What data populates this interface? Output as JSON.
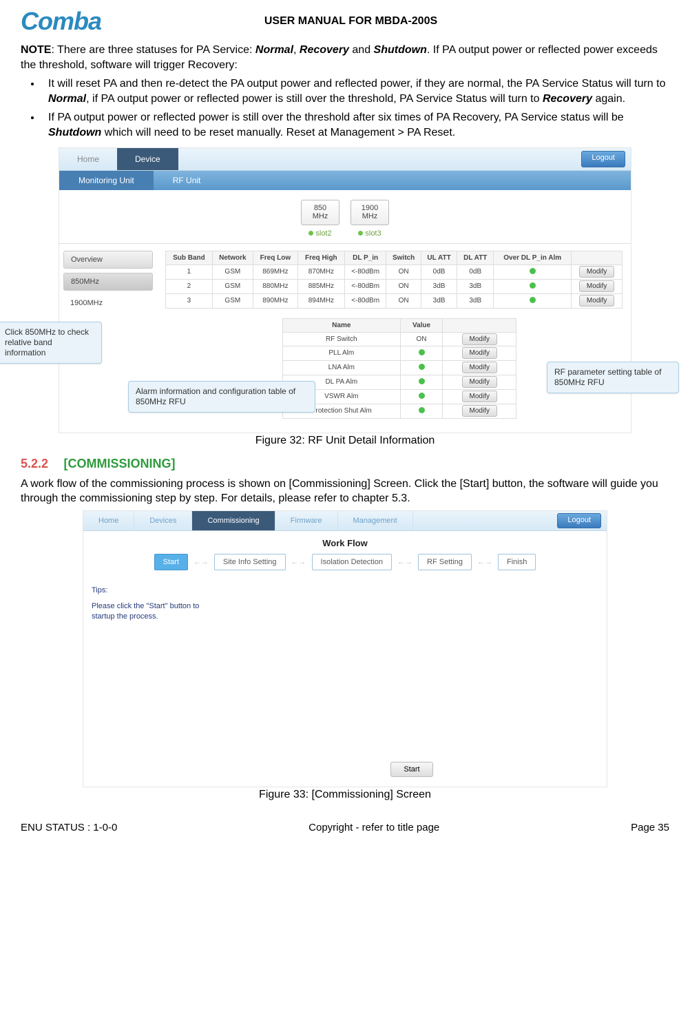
{
  "header": {
    "logo_text": "Comba",
    "title": "USER MANUAL FOR MBDA-200S"
  },
  "note": {
    "lead_bold": "NOTE",
    "lead_rest": ": There are three statuses for PA Service: ",
    "s1": "Normal",
    "s2": "Recovery",
    "s3": "Shutdown",
    "tail": ". If PA output power or reflected power exceeds the threshold, software will trigger Recovery:"
  },
  "bullets": {
    "b1a": "It will reset PA and then re-detect the PA output power and reflected power, if they are normal, the PA Service Status will turn to ",
    "b1_normal": "Normal",
    "b1b": ", if PA output power or reflected power is still over the threshold, PA Service Status will turn to ",
    "b1_recovery": "Recovery",
    "b1c": " again.",
    "b2a": "If PA output power or reflected power is still over the threshold after six times of PA Recovery, PA Service status will be ",
    "b2_shutdown": "Shutdown",
    "b2b": " which will need to be reset manually. Reset at Management > PA Reset."
  },
  "fig32": {
    "nav": {
      "home": "Home",
      "device": "Device",
      "logout": "Logout"
    },
    "subnav": {
      "mu": "Monitoring Unit",
      "rf": "RF Unit"
    },
    "slots": [
      {
        "line1": "850",
        "line2": "MHz",
        "label": "slot2"
      },
      {
        "line1": "1900",
        "line2": "MHz",
        "label": "slot3"
      }
    ],
    "sidebar": {
      "overview": "Overview",
      "b850": "850MHz",
      "b1900": "1900MHz"
    },
    "cols": [
      "Sub Band",
      "Network",
      "Freq Low",
      "Freq High",
      "DL P_in",
      "Switch",
      "UL ATT",
      "DL ATT",
      "Over DL P_in Alm",
      ""
    ],
    "rows": [
      [
        "1",
        "GSM",
        "869MHz",
        "870MHz",
        "<-80dBm",
        "ON",
        "0dB",
        "0dB"
      ],
      [
        "2",
        "GSM",
        "880MHz",
        "885MHz",
        "<-80dBm",
        "ON",
        "3dB",
        "3dB"
      ],
      [
        "3",
        "GSM",
        "890MHz",
        "894MHz",
        "<-80dBm",
        "ON",
        "3dB",
        "3dB"
      ]
    ],
    "modify": "Modify",
    "nv_cols": [
      "Name",
      "Value",
      ""
    ],
    "nv_rows": [
      [
        "RF Switch",
        "ON"
      ],
      [
        "PLL Alm",
        "led"
      ],
      [
        "LNA Alm",
        "led"
      ],
      [
        "DL PA Alm",
        "led"
      ],
      [
        "VSWR Alm",
        "led"
      ],
      [
        "Protection Shut Alm",
        "led"
      ]
    ],
    "callouts": {
      "left": "Click 850MHz to check relative band information",
      "mid": "Alarm information and configuration table of 850MHz RFU",
      "right": "RF parameter setting table of 850MHz RFU"
    },
    "caption": "Figure 32: RF Unit Detail Information"
  },
  "section": {
    "num": "5.2.2",
    "title": "[COMMISSIONING]",
    "para": "A work flow of the commissioning process is shown on [Commissioning] Screen. Click the [Start] button, the software will guide you through the commissioning step by step. For details, please refer to chapter 5.3."
  },
  "fig33": {
    "nav": [
      "Home",
      "Devices",
      "Commissioning",
      "Firmware",
      "Management"
    ],
    "logout": "Logout",
    "wf_title": "Work Flow",
    "steps": [
      "Start",
      "Site Info Setting",
      "Isolation Detection",
      "RF Setting",
      "Finish"
    ],
    "tips_label": "Tips:",
    "tips_text": "Please click the \"Start\" button to startup the process.",
    "start": "Start",
    "caption": "Figure 33: [Commissioning] Screen"
  },
  "footer": {
    "left": "ENU STATUS : 1-0-0",
    "center": "Copyright - refer to title page",
    "right": "Page 35"
  }
}
